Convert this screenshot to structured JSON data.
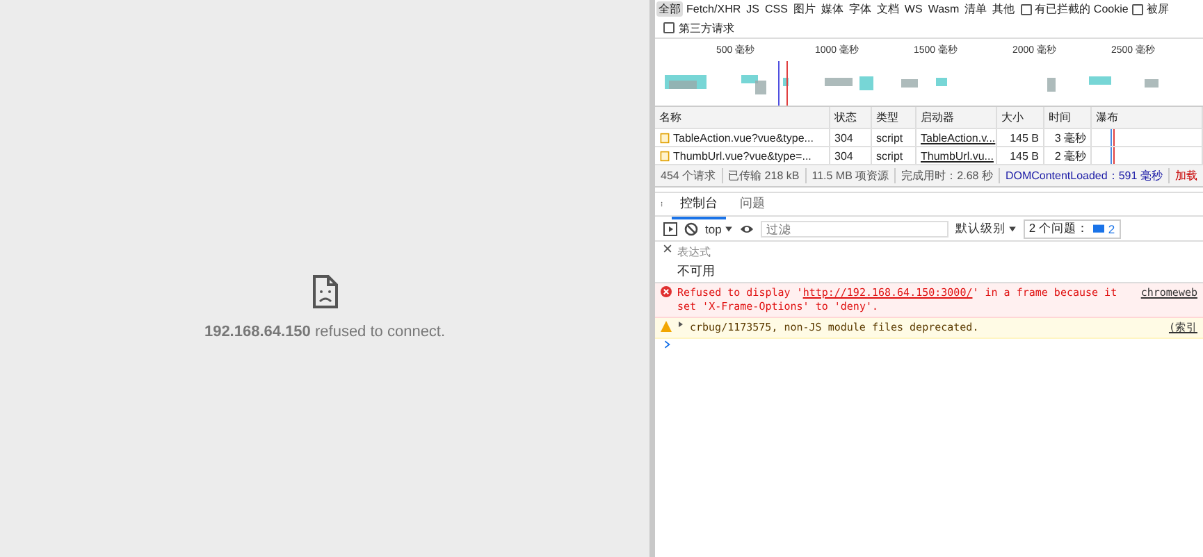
{
  "page": {
    "host": "192.168.64.150",
    "message": "refused to connect."
  },
  "devtools": {
    "filters": [
      {
        "label": "全部",
        "selected": true
      },
      {
        "label": "Fetch/XHR",
        "selected": false
      },
      {
        "label": "JS",
        "selected": false
      },
      {
        "label": "CSS",
        "selected": false
      },
      {
        "label": "图片",
        "selected": false
      },
      {
        "label": "媒体",
        "selected": false
      },
      {
        "label": "字体",
        "selected": false
      },
      {
        "label": "文档",
        "selected": false
      },
      {
        "label": "WS",
        "selected": false
      },
      {
        "label": "Wasm",
        "selected": false
      },
      {
        "label": "清单",
        "selected": false
      },
      {
        "label": "其他",
        "selected": false
      }
    ],
    "filter_checkboxes": [
      {
        "label": "有已拦截的 Cookie",
        "checked": false
      },
      {
        "label": "被屏",
        "checked": false
      }
    ],
    "third_party": {
      "label": "第三方请求",
      "checked": false
    },
    "timeline_ticks": [
      "500 毫秒",
      "1000 毫秒",
      "1500 毫秒",
      "2000 毫秒",
      "2500 毫秒"
    ],
    "table": {
      "columns": [
        "名称",
        "状态",
        "类型",
        "启动器",
        "大小",
        "时间",
        "瀑布"
      ],
      "rows": [
        [
          "TableAction.vue?vue&type...",
          "304",
          "script",
          "TableAction.v...",
          "145 B",
          "3 毫秒"
        ],
        [
          "ThumbUrl.vue?vue&type=...",
          "304",
          "script",
          "ThumbUrl.vu...",
          "145 B",
          "2 毫秒"
        ]
      ]
    },
    "summary": [
      {
        "text": "454 个请求",
        "color": "#555555"
      },
      {
        "text": "已传输 218 kB",
        "color": "#555555"
      },
      {
        "text": "11.5 MB 项资源",
        "color": "#555555"
      },
      {
        "text": "完成用时：2.68 秒",
        "color": "#555555"
      },
      {
        "text": "DOMContentLoaded：591 毫秒",
        "color": "#1a1aa6"
      },
      {
        "text": "加载",
        "color": "#c80000"
      }
    ],
    "drawer_tabs": [
      {
        "label": "控制台",
        "selected": true
      },
      {
        "label": "问题",
        "selected": false
      }
    ],
    "console_toolbar": {
      "context": "top",
      "filter_placeholder": "过滤",
      "level": "默认级别",
      "issues": "2 个问题：",
      "issue_count": "2"
    },
    "expression": {
      "label": "表达式",
      "value": "不可用"
    },
    "messages": [
      {
        "kind": "error",
        "before": "Refused to display '",
        "link": "http://192.168.64.150:3000/",
        "after": "' in a frame because it set 'X-Frame-Options' to 'deny'.",
        "source": "chromeweb"
      },
      {
        "kind": "warning",
        "before": "crbug/1173575, non-JS module files deprecated.",
        "source": "(索引"
      }
    ]
  }
}
